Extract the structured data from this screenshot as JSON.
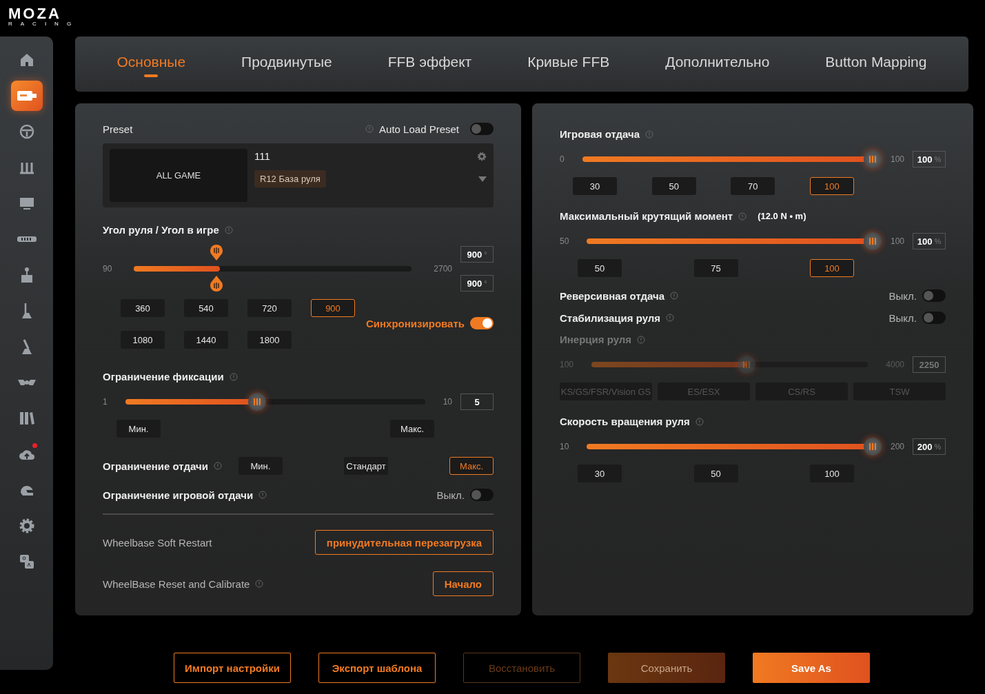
{
  "logo": {
    "name": "MOZA",
    "sub": "RACING"
  },
  "sidebar": {
    "items": [
      {
        "kind": "home",
        "selected": false,
        "badge": false
      },
      {
        "kind": "wheelbase",
        "selected": true,
        "badge": false
      },
      {
        "kind": "wheel",
        "selected": false,
        "badge": false
      },
      {
        "kind": "pedals",
        "selected": false,
        "badge": false
      },
      {
        "kind": "dash",
        "selected": false,
        "badge": false
      },
      {
        "kind": "ledbar",
        "selected": false,
        "badge": false
      },
      {
        "kind": "joystick",
        "selected": false,
        "badge": false
      },
      {
        "kind": "shifter",
        "selected": false,
        "badge": false
      },
      {
        "kind": "handbrake",
        "selected": false,
        "badge": false
      },
      {
        "kind": "hub",
        "selected": false,
        "badge": false
      },
      {
        "kind": "library",
        "selected": false,
        "badge": false
      },
      {
        "kind": "cloud",
        "selected": false,
        "badge": true
      },
      {
        "kind": "helmet",
        "selected": false,
        "badge": false
      },
      {
        "kind": "settings",
        "selected": false,
        "badge": false
      },
      {
        "kind": "qa",
        "selected": false,
        "badge": false
      }
    ]
  },
  "tabs": [
    {
      "label": "Основные",
      "selected": true
    },
    {
      "label": "Продвинутые",
      "selected": false
    },
    {
      "label": "FFB эффект",
      "selected": false
    },
    {
      "label": "Кривые FFB",
      "selected": false
    },
    {
      "label": "Дополнительно",
      "selected": false
    },
    {
      "label": "Button Mapping",
      "selected": false
    }
  ],
  "left": {
    "preset": {
      "label": "Preset",
      "auto_load": {
        "label": "Auto Load Preset",
        "on": false
      },
      "image_label": "ALL GAME",
      "name": "111",
      "tag": "R12 База руля"
    },
    "angle": {
      "title": "Угол руля / Угол в игре",
      "min": "90",
      "max": "2700",
      "level": 0.31,
      "values": [
        "900",
        "900"
      ],
      "unit": "°",
      "presets": [
        {
          "label": "360",
          "selected": false
        },
        {
          "label": "540",
          "selected": false
        },
        {
          "label": "720",
          "selected": false
        },
        {
          "label": "900",
          "selected": true
        },
        {
          "label": "1080",
          "selected": false
        },
        {
          "label": "1440",
          "selected": false
        },
        {
          "label": "1800",
          "selected": false
        }
      ],
      "sync": {
        "label": "Синхронизировать",
        "on": true
      }
    },
    "lock": {
      "title": "Ограничение фиксации",
      "min": "1",
      "max": "10",
      "level": 0.44,
      "value": "5",
      "buttons": [
        "Мин.",
        "Макс."
      ]
    },
    "output_limit": {
      "title": "Ограничение отдачи",
      "options": [
        {
          "label": "Мин.",
          "selected": false
        },
        {
          "label": "Стандарт",
          "selected": false
        },
        {
          "label": "Макс.",
          "selected": true
        }
      ]
    },
    "game_limit": {
      "title": "Ограничение игровой отдачи",
      "state": "Выкл.",
      "on": false
    },
    "actions": [
      {
        "label": "Wheelbase Soft Restart",
        "info": false,
        "button": "принудительная перезагрузка"
      },
      {
        "label": "WheelBase Reset and Calibrate",
        "info": true,
        "button": "Начало"
      }
    ]
  },
  "right": [
    {
      "kind": "slider",
      "title": "Игровая отдача",
      "min": "0",
      "max": "100",
      "level": 1,
      "value": "100",
      "unit": "%",
      "disabled": false,
      "presets": [
        {
          "label": "30",
          "selected": false
        },
        {
          "label": "50",
          "selected": false
        },
        {
          "label": "70",
          "selected": false
        },
        {
          "label": "100",
          "selected": true
        }
      ]
    },
    {
      "kind": "slider",
      "title": "Максимальный крутящий момент",
      "note": "(12.0 N • m)",
      "min": "50",
      "max": "100",
      "level": 1,
      "value": "100",
      "unit": "%",
      "disabled": false,
      "presets": [
        {
          "label": "50",
          "selected": false
        },
        {
          "label": "75",
          "selected": false
        },
        {
          "label": "100",
          "selected": true
        }
      ]
    },
    {
      "kind": "toggle",
      "title": "Реверсивная отдача",
      "state": "Выкл.",
      "on": false
    },
    {
      "kind": "toggle",
      "title": "Стабилизация руля",
      "state": "Выкл.",
      "on": false
    },
    {
      "kind": "slider",
      "title": "Инерция руля",
      "min": "100",
      "max": "4000",
      "level": 0.56,
      "value": "2250",
      "disabled": true,
      "presets": [
        {
          "label": "KS/GS/FSR/Vision GS",
          "selected": false
        },
        {
          "label": "ES/ESX",
          "selected": false
        },
        {
          "label": "CS/RS",
          "selected": false
        },
        {
          "label": "TSW",
          "selected": false
        }
      ]
    },
    {
      "kind": "slider",
      "title": "Скорость вращения руля",
      "min": "10",
      "max": "200",
      "level": 1,
      "value": "200",
      "unit": "%",
      "disabled": false,
      "presets": [
        {
          "label": "30",
          "selected": false
        },
        {
          "label": "50",
          "selected": false
        },
        {
          "label": "100",
          "selected": false
        }
      ]
    }
  ],
  "footer": [
    {
      "label": "Импорт настройки",
      "kind": "outline"
    },
    {
      "label": "Экспорт шаблона",
      "kind": "outline"
    },
    {
      "label": "Восстановить",
      "kind": "disabled"
    },
    {
      "label": "Сохранить",
      "kind": "muted"
    },
    {
      "label": "Save As",
      "kind": "primary"
    }
  ]
}
